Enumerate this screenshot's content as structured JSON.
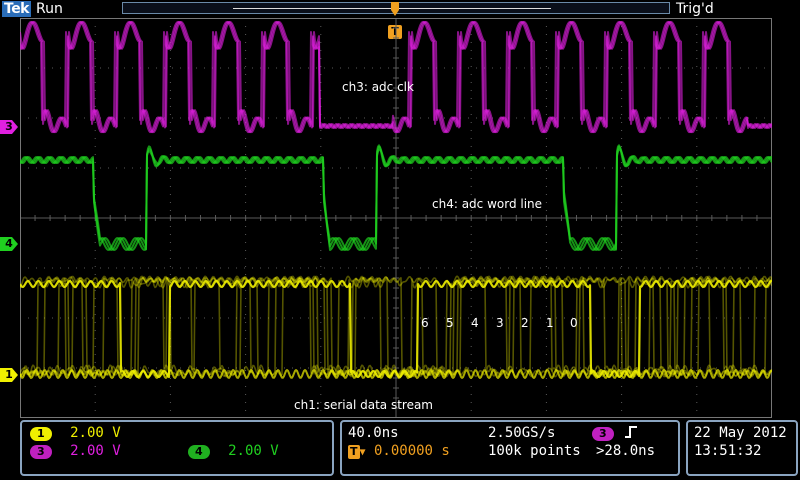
{
  "header": {
    "brand": "Tek",
    "run_state": "Run",
    "trigger_state": "Trig'd"
  },
  "colors": {
    "ch1": "#f0f000",
    "ch3": "#e020e0",
    "ch4": "#20d020",
    "trigger": "#f0a020",
    "grid": "#5a5a5a",
    "panel_border": "#8aa4c0"
  },
  "markers": {
    "ch1": "1",
    "ch3": "3",
    "ch4": "4",
    "trigger": "T"
  },
  "annotations": {
    "ch3": "ch3: adc clk",
    "ch4": "ch4: adc word line",
    "ch1": "ch1: serial data stream",
    "bits": [
      "6",
      "5",
      "4",
      "3",
      "2",
      "1",
      "0"
    ]
  },
  "vertical_panel": {
    "ch1_badge": "1",
    "ch1_scale": "2.00 V",
    "ch3_badge": "3",
    "ch3_scale": "2.00 V",
    "ch4_badge": "4",
    "ch4_scale": "2.00 V"
  },
  "horizontal_panel": {
    "time_div": "40.0ns",
    "sample_rate": "2.50GS/s",
    "trigger_badge": "3",
    "trigger_icon": "rising-edge-icon",
    "delay": "0.00000 s",
    "record_length": "100k points",
    "trigger_level": ">28.0ns"
  },
  "datetime_panel": {
    "date": "22 May 2012",
    "time": "13:51:32"
  }
}
